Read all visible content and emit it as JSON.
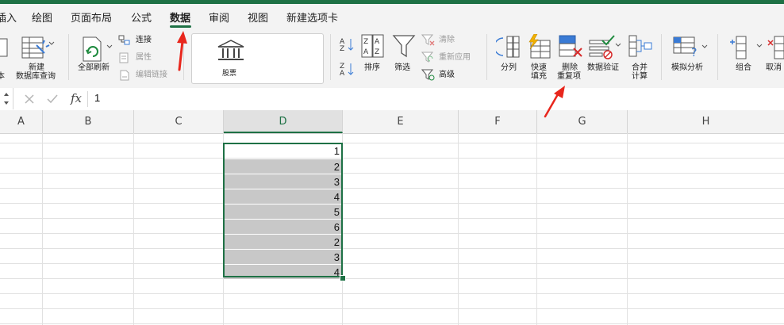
{
  "ribbon_tabs": {
    "insert_partial": "插入",
    "draw": "绘图",
    "page_layout": "页面布局",
    "formulas": "公式",
    "data": "数据",
    "review": "审阅",
    "view": "视图",
    "new_tab": "新建选项卡"
  },
  "ribbon": {
    "from_text_partial": "本",
    "new_db_query_1": "新建",
    "new_db_query_2": "数据库查询",
    "refresh_all": "全部刷新",
    "connections": "连接",
    "properties": "属性",
    "edit_links": "编辑链接",
    "stocks": "股票",
    "sort": "排序",
    "filter": "筛选",
    "clear": "清除",
    "reapply": "重新应用",
    "advanced": "高级",
    "text_to_columns": "分列",
    "flash_fill_1": "快速",
    "flash_fill_2": "填充",
    "remove_duplicates_1": "删除",
    "remove_duplicates_2": "重复项",
    "data_validation": "数据验证",
    "consolidate_1": "合并",
    "consolidate_2": "计算",
    "what_if": "模拟分析",
    "group": "组合",
    "ungroup_partial": "取消"
  },
  "formula_bar": {
    "fx": "fx",
    "value": "1"
  },
  "columns": [
    "A",
    "B",
    "C",
    "D",
    "E",
    "F",
    "G",
    "H"
  ],
  "column_d_values": [
    "1",
    "2",
    "3",
    "4",
    "5",
    "6",
    "2",
    "3",
    "4"
  ],
  "colors": {
    "accent": "#1e7145",
    "annotation_arrow": "#e8261c",
    "selection_fill": "#c8c8c8"
  }
}
